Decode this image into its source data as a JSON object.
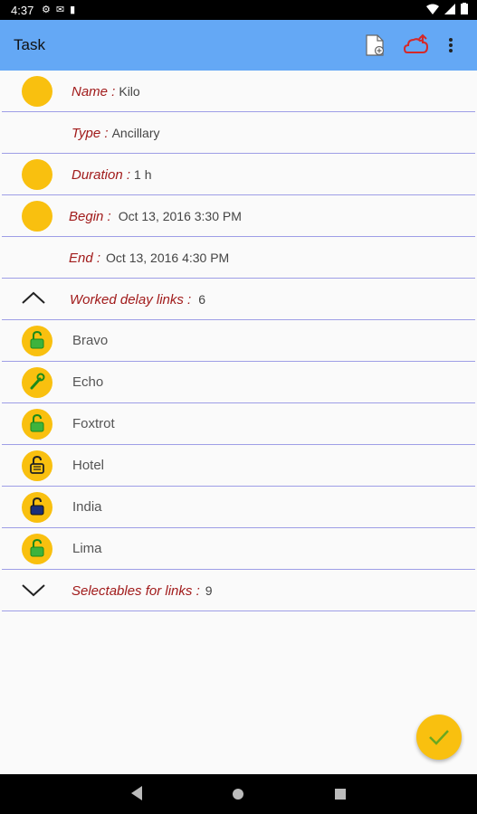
{
  "status": {
    "time": "4:37"
  },
  "appbar": {
    "title": "Task"
  },
  "fields": [
    {
      "label": "Name :",
      "value": "Kilo",
      "has_icon": true
    },
    {
      "label": "Type :",
      "value": "Ancillary",
      "has_icon": false
    },
    {
      "label": "Duration :",
      "value": "1 h",
      "has_icon": true
    },
    {
      "label": "Begin :",
      "value": "Oct 13, 2016 3:30 PM",
      "has_icon": true
    },
    {
      "label": "End :",
      "value": "Oct 13, 2016 4:30 PM",
      "has_icon": false
    }
  ],
  "worked": {
    "label": "Worked delay links :",
    "count": "6"
  },
  "links": [
    {
      "name": "Bravo",
      "icon": "lock-open-green"
    },
    {
      "name": "Echo",
      "icon": "wrench-green"
    },
    {
      "name": "Foxtrot",
      "icon": "lock-open-green"
    },
    {
      "name": "Hotel",
      "icon": "lock-open-outline"
    },
    {
      "name": "India",
      "icon": "lock-navy"
    },
    {
      "name": "Lima",
      "icon": "lock-open-green"
    }
  ],
  "selectables": {
    "label": "Selectables for links :",
    "count": "9"
  },
  "colors": {
    "appbar": "#64a8f5",
    "accent": "#f9c00f",
    "label": "#a11b1b",
    "divider": "#9e9ee6"
  }
}
